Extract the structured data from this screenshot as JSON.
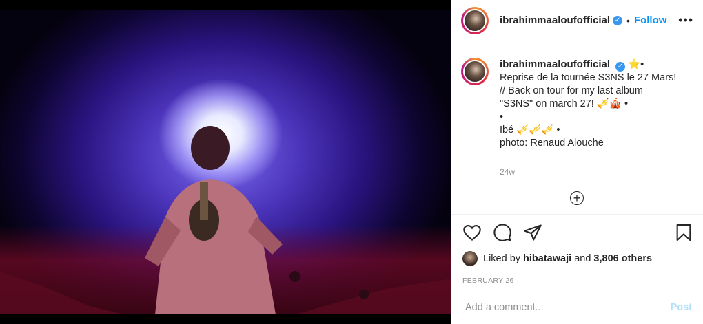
{
  "post": {
    "username": "ibrahimmaaloufofficial",
    "verified_glyph": "✓",
    "follow_label": "Follow",
    "more_label": "•••",
    "separator": "•"
  },
  "caption": {
    "username": "ibrahimmaaloufofficial",
    "lines": [
      "⭐•",
      "Reprise de la tournée S3NS le 27 Mars!",
      "// Back on tour for my last album",
      "\"S3NS\" on march 27! 🎺🎪 •",
      "•",
      "Ibé 🎺🎺🎺 •",
      "photo: Renaud Alouche"
    ],
    "age": "24w"
  },
  "actions": {
    "like_icon": "heart-icon",
    "comment_icon": "comment-icon",
    "share_icon": "share-icon",
    "save_icon": "bookmark-icon"
  },
  "likes": {
    "prefix": "Liked by",
    "user": "hibatawaji",
    "middle": "and",
    "others": "3,806 others"
  },
  "date": "FEBRUARY 26",
  "comment": {
    "placeholder": "Add a comment...",
    "post_label": "Post"
  }
}
